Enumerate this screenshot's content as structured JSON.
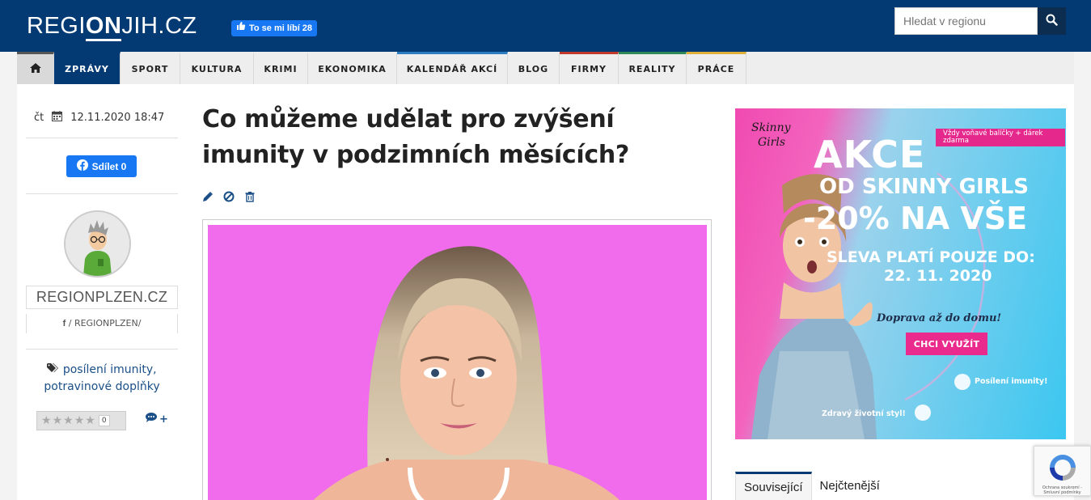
{
  "header": {
    "logo_prefix": "REGI",
    "logo_bold": "ON",
    "logo_suffix": "JIH.CZ",
    "fb_like_label": "To se mi líbí 28",
    "search_placeholder": "Hledat v regionu"
  },
  "nav": {
    "items": [
      {
        "label": "ZPRÁVY"
      },
      {
        "label": "SPORT"
      },
      {
        "label": "KULTURA"
      },
      {
        "label": "KRIMI"
      },
      {
        "label": "EKONOMIKA"
      },
      {
        "label": "KALENDÁŘ AKCÍ"
      },
      {
        "label": "BLOG"
      },
      {
        "label": "FIRMY"
      },
      {
        "label": "REALITY"
      },
      {
        "label": "PRÁCE"
      }
    ],
    "accent_colors": [
      "#033a73",
      "#555555",
      "#555555",
      "#555555",
      "#555555",
      "#2d7dc2",
      "#555555",
      "#c0392b",
      "#2e8b57",
      "#e0b13a"
    ]
  },
  "article": {
    "day": "čt",
    "datetime": "12.11.2020 18:47",
    "share_label": "Sdílet 0",
    "title": "Co můžeme udělat pro zvýšení imunity v podzimních měsících?",
    "author": "REGIONPLZEN.CZ",
    "author_social": "/ REGIONPLZEN/",
    "tags": [
      "posílení imunity,",
      "potravinové doplňky"
    ],
    "rating_count": "0",
    "comments_label": "+"
  },
  "ad": {
    "brand_line1": "Skinny",
    "brand_line2": "Girls",
    "badge": "Vždy voňavé balíčky + dárek zdarma",
    "headline1": "AKCE",
    "headline2": "OD SKINNY GIRLS",
    "headline3": "-20% NA VŠE",
    "validity1": "SLEVA PLATÍ POUZE DO:",
    "validity2": "22. 11. 2020",
    "delivery": "Doprava až do domu!",
    "cta": "CHCI VYUŽÍT",
    "feature1": "Posílení imunity!",
    "feature2": "Zdravý životní styl!"
  },
  "tabs": [
    "Související",
    "Nejčtenější"
  ],
  "recaptcha": "Ochrana soukromí - Smluvní podmínky"
}
